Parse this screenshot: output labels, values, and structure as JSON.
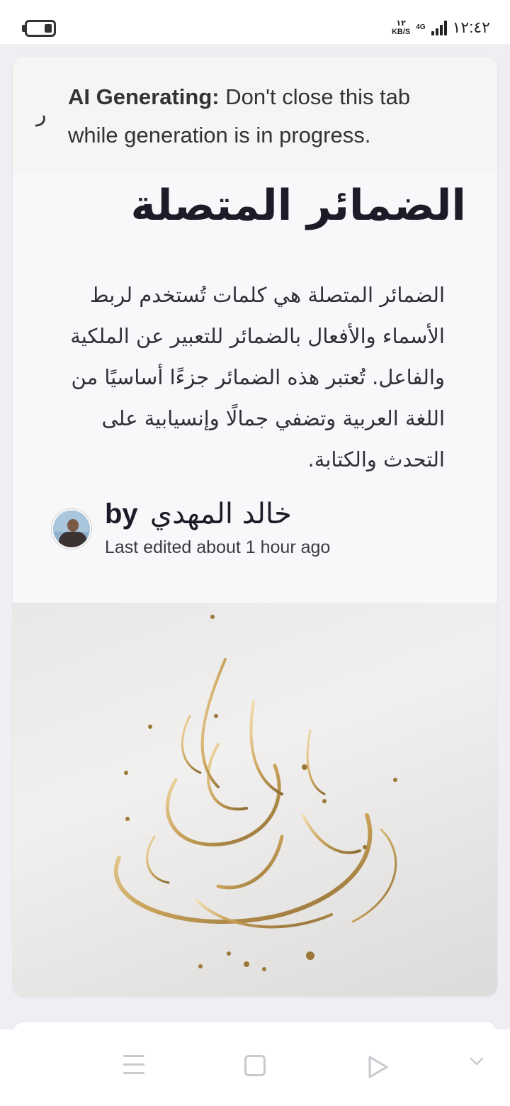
{
  "status_bar": {
    "speed_value": "١٢",
    "speed_unit": "KB/S",
    "network": "4G",
    "time": "١٢:٤٢",
    "icons": [
      "battery-icon",
      "signal-icon"
    ]
  },
  "banner": {
    "label": "AI Generating:",
    "message": "Don't close this tab while generation is in progress.",
    "spinner_glyph": "ر"
  },
  "article": {
    "title": "الضمائر المتصلة",
    "description": "الضمائر المتصلة هي كلمات تُستخدم لربط الأسماء والأفعال بالضمائر للتعبير عن الملكية والفاعل. تُعتبر هذه الضمائر جزءًا أساسيًا من اللغة العربية وتضفي جمالًا وإنسيابية على التحدث والكتابة.",
    "by_label": "by",
    "author_name": "خالد المهدي",
    "edited": "Last edited about 1 hour ago"
  },
  "nav_bar": {
    "icons": [
      "menu-icon",
      "home-square-icon",
      "back-triangle-icon",
      "chevron-down-icon"
    ]
  },
  "colors": {
    "gold": "#c9a25a",
    "text_dark": "#1c1c28",
    "banner_bg": "#f5f5f3"
  }
}
